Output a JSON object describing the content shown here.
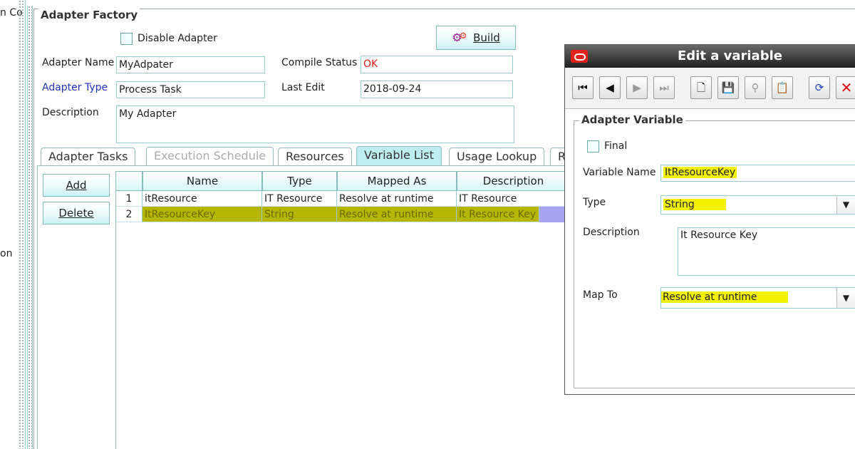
{
  "left_sidebar": {
    "top_text": "n Co",
    "mid_text": "on"
  },
  "factory": {
    "legend": "Adapter Factory",
    "disable_label": "Disable Adapter",
    "build_label": "Build",
    "name_label": "Adapter Name",
    "name_value": "MyAdpater",
    "compile_label": "Compile Status",
    "compile_value": "OK",
    "type_label": "Adapter Type",
    "type_value": "Process Task",
    "last_edit_label": "Last Edit",
    "last_edit_value": "2018-09-24",
    "desc_label": "Description",
    "desc_value": "My Adapter"
  },
  "tabs": [
    "Adapter Tasks",
    "Execution Schedule",
    "Resources",
    "Variable List",
    "Usage Lookup",
    "R"
  ],
  "side_buttons": {
    "add": "Add",
    "delete": "Delete"
  },
  "table": {
    "headers": [
      "Name",
      "Type",
      "Mapped As",
      "Description"
    ],
    "rows": [
      {
        "num": "1",
        "name": "itResource",
        "type": "IT Resource",
        "mapped": "Resolve at runtime",
        "desc": "IT Resource"
      },
      {
        "num": "2",
        "name": "ItResourceKey",
        "type": "String",
        "mapped": "Resolve at runtime",
        "desc": "It Resource Key"
      }
    ]
  },
  "dialog": {
    "title": "Edit a variable",
    "group_legend": "Adapter Variable",
    "final_label": "Final",
    "var_name_label": "Variable Name",
    "var_name_value": "ItResourceKey",
    "type_label": "Type",
    "type_value": "String",
    "desc_label": "Description",
    "desc_value": "It Resource Key",
    "map_label": "Map To",
    "map_value": "Resolve at runtime"
  },
  "colors": {
    "highlight": "#f2f200",
    "tab_active": "#bfeef0",
    "compile_ok": "#e02020",
    "close_red": "#e0001b"
  }
}
